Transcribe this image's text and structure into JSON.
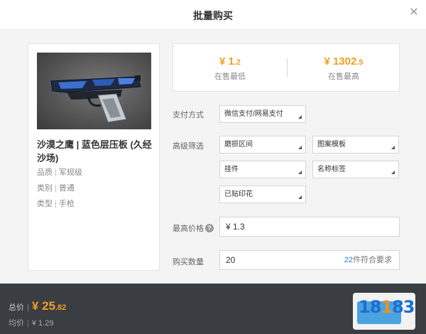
{
  "dialog": {
    "title": "批量购买",
    "close_glyph": "✕"
  },
  "item": {
    "name": "沙漠之鹰 | 蓝色层压板 (久经沙场)",
    "icon": "desert-eagle-pistol-image",
    "attributes": [
      {
        "key": "品质",
        "value": "军规级"
      },
      {
        "key": "类别",
        "value": "普通"
      },
      {
        "key": "类型",
        "value": "手枪"
      }
    ]
  },
  "prices": {
    "low": {
      "symbol": "¥",
      "int": "1",
      "dec": ".2",
      "label": "在售最低"
    },
    "high": {
      "symbol": "¥",
      "int": "1302",
      "dec": ".5",
      "label": "在售最高"
    }
  },
  "payment": {
    "label": "支付方式",
    "value": "微信支付/网易支付"
  },
  "filter": {
    "label": "高级筛选",
    "wear": "磨损区间",
    "pattern": "图案模板",
    "charm": "挂件",
    "nametag": "名称标签",
    "sticker": "已贴印花"
  },
  "max_price": {
    "label": "最高价格",
    "help_glyph": "?",
    "value": "¥ 1.3"
  },
  "quantity": {
    "label": "购买数量",
    "value": "20",
    "hint_num": "22",
    "hint_text": "件符合要求"
  },
  "footer": {
    "total_label": "总价",
    "total_symbol": "¥",
    "total_int": "25",
    "total_dec": ".82",
    "avg_label": "均价",
    "avg_value": "¥ 1.29",
    "sep": "|"
  },
  "colors": {
    "accent": "#f0a020",
    "link": "#2a7fd4",
    "footer_bg": "#3a3d42"
  }
}
